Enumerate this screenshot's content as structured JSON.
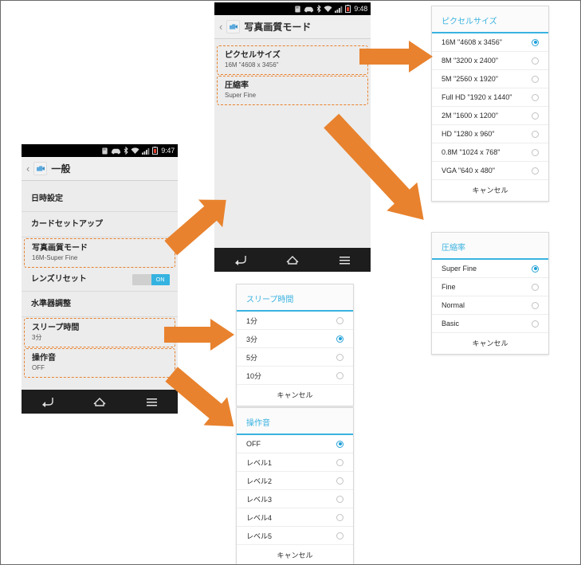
{
  "meta": {
    "accent_orange": "#e8822e",
    "accent_blue": "#3ab2e0",
    "phone_bg": "#ececec"
  },
  "phone_general": {
    "statusbar": {
      "time": "9:47",
      "icons": [
        "sd-card-icon",
        "car-icon",
        "bluetooth-icon",
        "wifi-icon",
        "signal-icon",
        "battery-icon"
      ]
    },
    "title": "一般",
    "back_chevron": "‹",
    "rows": [
      {
        "title": "日時設定",
        "sub": "",
        "type": "plain",
        "highlight": false
      },
      {
        "title": "カードセットアップ",
        "sub": "",
        "type": "plain",
        "highlight": false
      },
      {
        "title": "写真画質モード",
        "sub": "16M-Super Fine",
        "type": "value",
        "highlight": true
      },
      {
        "title": "レンズリセット",
        "sub": "",
        "type": "toggle",
        "highlight": false,
        "toggle_label": "ON"
      },
      {
        "title": "水準器調整",
        "sub": "",
        "type": "plain",
        "highlight": false
      },
      {
        "title": "スリープ時間",
        "sub": "3分",
        "type": "value",
        "highlight": true
      },
      {
        "title": "操作音",
        "sub": "OFF",
        "type": "value",
        "highlight": true
      }
    ],
    "navbar": [
      "back-icon",
      "home-icon",
      "menu-icon"
    ]
  },
  "phone_quality": {
    "statusbar": {
      "time": "9:48",
      "icons": [
        "sd-card-icon",
        "car-icon",
        "bluetooth-icon",
        "wifi-icon",
        "signal-icon",
        "battery-icon"
      ]
    },
    "title": "写真画質モード",
    "back_chevron": "‹",
    "rows": [
      {
        "title": "ピクセルサイズ",
        "sub": "16M \"4608 x 3456\"",
        "type": "value",
        "highlight": true
      },
      {
        "title": "圧縮率",
        "sub": "Super Fine",
        "type": "value",
        "highlight": true
      }
    ],
    "navbar": [
      "back-icon",
      "home-icon",
      "menu-icon"
    ]
  },
  "dialog_pixel_size": {
    "title": "ピクセルサイズ",
    "cancel": "キャンセル",
    "items": [
      {
        "label": "16M \"4608 x 3456\"",
        "selected": true
      },
      {
        "label": "8M \"3200 x 2400\"",
        "selected": false
      },
      {
        "label": "5M \"2560 x 1920\"",
        "selected": false
      },
      {
        "label": "Full HD \"1920 x 1440\"",
        "selected": false
      },
      {
        "label": "2M \"1600 x 1200\"",
        "selected": false
      },
      {
        "label": "HD \"1280 x 960\"",
        "selected": false
      },
      {
        "label": "0.8M \"1024 x 768\"",
        "selected": false
      },
      {
        "label": "VGA \"640 x 480\"",
        "selected": false
      }
    ]
  },
  "dialog_compression": {
    "title": "圧縮率",
    "cancel": "キャンセル",
    "items": [
      {
        "label": "Super Fine",
        "selected": true
      },
      {
        "label": "Fine",
        "selected": false
      },
      {
        "label": "Normal",
        "selected": false
      },
      {
        "label": "Basic",
        "selected": false
      }
    ]
  },
  "dialog_sleep": {
    "title": "スリープ時間",
    "cancel": "キャンセル",
    "items": [
      {
        "label": "1分",
        "selected": false
      },
      {
        "label": "3分",
        "selected": true
      },
      {
        "label": "5分",
        "selected": false
      },
      {
        "label": "10分",
        "selected": false
      }
    ]
  },
  "dialog_sound": {
    "title": "操作音",
    "cancel": "キャンセル",
    "items": [
      {
        "label": "OFF",
        "selected": true
      },
      {
        "label": "レベル1",
        "selected": false
      },
      {
        "label": "レベル2",
        "selected": false
      },
      {
        "label": "レベル3",
        "selected": false
      },
      {
        "label": "レベル4",
        "selected": false
      },
      {
        "label": "レベル5",
        "selected": false
      }
    ]
  },
  "arrows": [
    {
      "name": "arrow-general-to-quality",
      "kind": "diagonal-up-right"
    },
    {
      "name": "arrow-quality-to-pixelsize",
      "kind": "horizontal-right"
    },
    {
      "name": "arrow-quality-to-compression",
      "kind": "diagonal-down-right"
    },
    {
      "name": "arrow-general-to-sleep",
      "kind": "horizontal-right"
    },
    {
      "name": "arrow-general-to-sound",
      "kind": "diagonal-down-right"
    }
  ]
}
